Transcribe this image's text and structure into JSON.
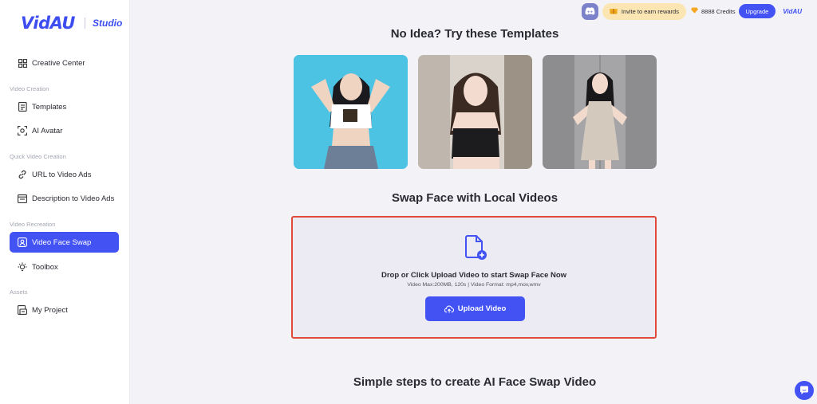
{
  "brand": {
    "logo": "VidAU",
    "product": "Studio",
    "mini_logo": "VidAU"
  },
  "sidebar": {
    "top_item": {
      "label": "Creative Center",
      "icon": "grid-icon"
    },
    "sections": [
      {
        "label": "Video Creation",
        "items": [
          {
            "label": "Templates",
            "icon": "template-doc-icon"
          },
          {
            "label": "AI Avatar",
            "icon": "avatar-scan-icon"
          }
        ]
      },
      {
        "label": "Quick Video Creation",
        "items": [
          {
            "label": "URL to Video Ads",
            "icon": "link-icon"
          },
          {
            "label": "Description to Video Ads",
            "icon": "description-icon"
          }
        ]
      },
      {
        "label": "Video Recreation",
        "items": [
          {
            "label": "Video Face Swap",
            "icon": "face-swap-icon",
            "active": true
          },
          {
            "label": "Toolbox",
            "icon": "lightbulb-icon"
          }
        ]
      },
      {
        "label": "Assets",
        "items": [
          {
            "label": "My Project",
            "icon": "project-icon"
          }
        ]
      }
    ]
  },
  "topbar": {
    "invite_label": "Invite to earn rewards",
    "credits_label": "8888 Credits",
    "upgrade_label": "Upgrade"
  },
  "main": {
    "templates_title": "No Idea? Try these Templates",
    "local_title": "Swap Face with Local Videos",
    "drop_title": "Drop or Click Upload Video to start Swap Face Now",
    "drop_sub": "Video Max:200MB, 120s | Video Format: mp4,mov,wmv",
    "upload_label": "Upload Video",
    "steps_title": "Simple steps to create AI Face Swap Video"
  },
  "colors": {
    "accent": "#4352f3",
    "highlight_border": "#e14a3b",
    "invite_bg": "#fbe6b3"
  }
}
